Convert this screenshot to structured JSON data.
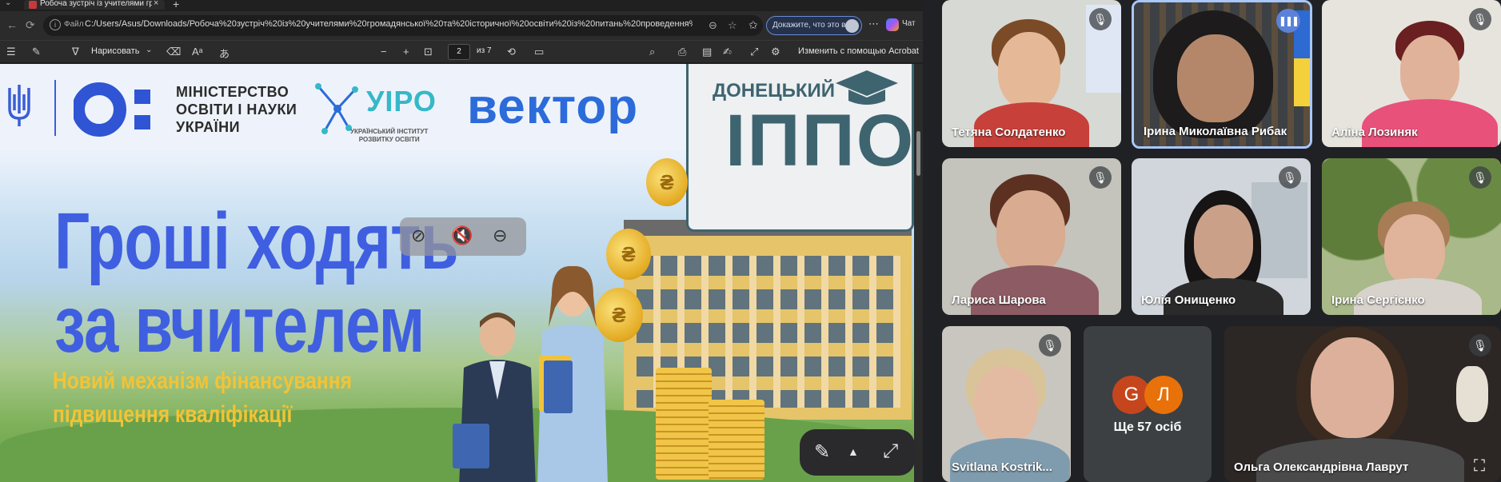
{
  "browser": {
    "tab": {
      "title": "Робоча зустріч із учителями гро",
      "close": "×"
    },
    "new_tab": "+",
    "tab_list": "⌄",
    "nav": {
      "back": "←",
      "reload": "⟳"
    },
    "address": {
      "info": "i",
      "protocol": "Файл",
      "url": "C:/Users/Asus/Downloads/Робоча%20зустріч%20із%20учителями%20громадянської%20та%20історичної%20освіти%20із%20питань%20проведення%20підв..."
    },
    "url_actions": {
      "zoom": "⊖",
      "favorite": "☆"
    },
    "toolbar_right": {
      "favorites": "✩",
      "profile_text": "Докажите, что это вы",
      "more": "⋯",
      "chat_label": "Чат"
    }
  },
  "pdf_toolbar": {
    "contents": "☰",
    "highlight": "✎",
    "draw_label": "Нарисовать",
    "draw_chevron": "⌄",
    "eraser": "⌫",
    "text": "Aᵃ",
    "read_aloud": "あ",
    "zoom_out": "−",
    "zoom_in": "+",
    "fit": "⊡",
    "page": "2",
    "of_pages": "из 7",
    "rotate": "⟲",
    "two_page": "▭",
    "search": "⌕",
    "print": "⎙",
    "save_as": "▤",
    "edit": "✍",
    "fullscreen": "⤢",
    "settings": "⚙",
    "acrobat_label": "Изменить с помощью Acrobat"
  },
  "slide": {
    "ministry": "МІНІСТЕРСТВО\nОСВІТИ І НАУКИ\nУКРАЇНИ",
    "uiro": "УІРО",
    "uiro_sub": "УКРАЇНСЬКИЙ ІНСТИТУТ\nРОЗВИТКУ ОСВІТИ",
    "vektor": "вектор",
    "donetsk": "ДОНЕЦЬКИЙ",
    "ippo": "ІППО",
    "headline": "Гроші ходять\nза вчителем",
    "subline": "Новий механізм фінансування\nпідвищення кваліфікації",
    "coin_symbol": "₴"
  },
  "float_controls": {
    "pin": "⊘",
    "mute": "🔇",
    "remove": "⊖"
  },
  "presenter_controls": {
    "annotate": "✎",
    "menu": "▲",
    "expand": "⤢"
  },
  "participants": [
    {
      "name": "Тетяна Солдатенко",
      "muted": true
    },
    {
      "name": "Ірина Миколаївна Рибак",
      "muted": false,
      "speaking": true
    },
    {
      "name": "Аліна Лозиняк",
      "muted": true
    },
    {
      "name": "Лариса Шарова",
      "muted": true
    },
    {
      "name": "Юлія Онищенко",
      "muted": true
    },
    {
      "name": "Ірина Сергієнко",
      "muted": true
    },
    {
      "name": "Svitlana Kostrik...",
      "muted": true
    },
    {
      "name": "Ольга Олександрівна Лаврут",
      "muted": true
    }
  ],
  "more_tile": {
    "avatars": [
      "G",
      "Л"
    ],
    "text": "Ще 57 осіб"
  },
  "icons": {
    "mic_off": "🎙",
    "speaking": "❚❚❚",
    "crop": "⛶"
  },
  "colors": {
    "meet_bg": "#202124",
    "brand_blue": "#3f5fe0",
    "subline_yellow": "#f3c336",
    "avatar_g": "#c5461d",
    "avatar_l": "#e8710a"
  }
}
